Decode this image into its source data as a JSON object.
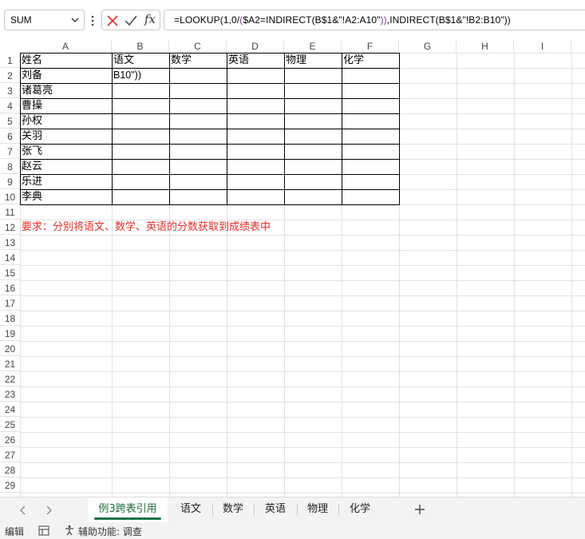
{
  "formula_bar": {
    "name_box": "SUM",
    "fx_label": "fx",
    "formula_prefix": "=LOOKUP(1,0/",
    "formula_paren1": "(",
    "formula_mid": "$A2=INDIRECT(B$1&\"!A2:A10\"",
    "formula_paren2": "))",
    "formula_suffix": ",INDIRECT(B$1&\"!B2:B10\"))"
  },
  "columns": [
    "A",
    "B",
    "C",
    "D",
    "E",
    "F",
    "G",
    "H",
    "I"
  ],
  "rows": [
    "1",
    "2",
    "3",
    "4",
    "5",
    "6",
    "7",
    "8",
    "9",
    "10",
    "11",
    "12",
    "13",
    "14",
    "15",
    "16",
    "17",
    "18",
    "19",
    "20",
    "21",
    "22",
    "23",
    "24",
    "25",
    "26",
    "27",
    "28",
    "29"
  ],
  "table": {
    "header": [
      "姓名",
      "语文",
      "数学",
      "英语",
      "物理",
      "化学"
    ],
    "names": [
      "刘备",
      "诸葛亮",
      "曹操",
      "孙权",
      "关羽",
      "张飞",
      "赵云",
      "乐进",
      "李典"
    ],
    "editing_cell_text": "B10\"))"
  },
  "note": "要求：分别将语文、数学、英语的分数获取到成绩表中",
  "sheet_tabs": [
    "例3跨表引用",
    "语文",
    "数学",
    "英语",
    "物理",
    "化学"
  ],
  "active_tab_index": 0,
  "status": {
    "mode": "编辑",
    "accessibility": "辅助功能: 调查"
  },
  "colors": {
    "note_red": "#e0302a",
    "active_tab_green": "#1e7145",
    "formula_paren_color": "#7a3aa0"
  }
}
